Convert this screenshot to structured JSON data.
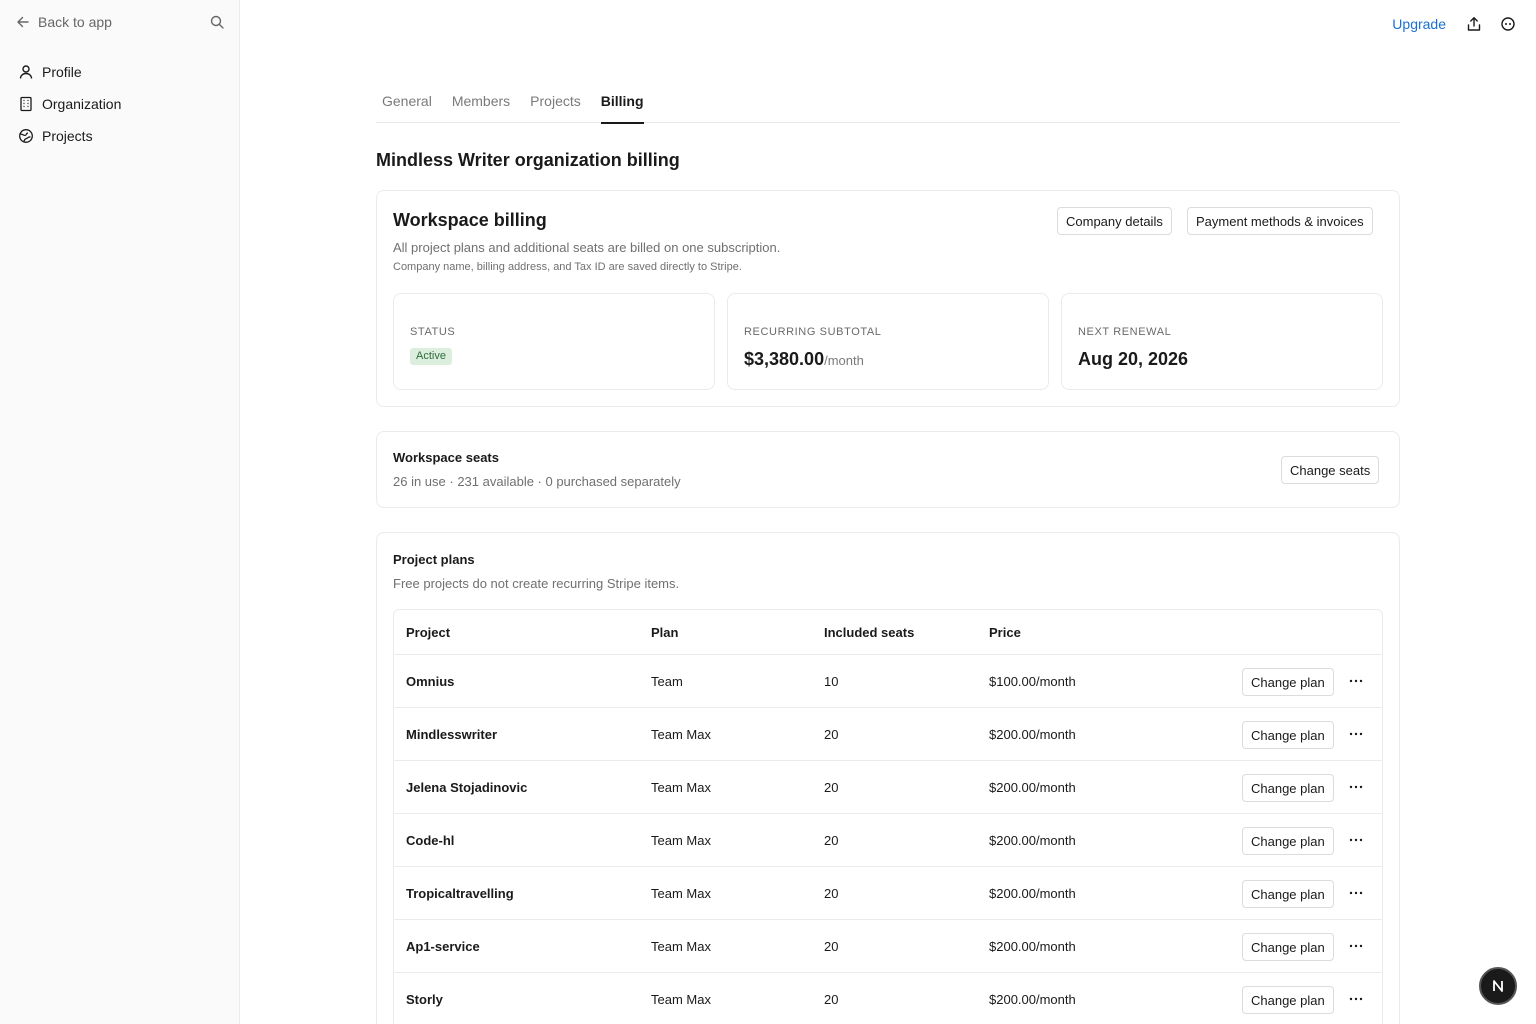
{
  "sidebar": {
    "back_label": "Back to app",
    "items": [
      {
        "label": "Profile",
        "icon": "user-icon"
      },
      {
        "label": "Organization",
        "icon": "building-icon"
      },
      {
        "label": "Projects",
        "icon": "globe-icon"
      }
    ]
  },
  "topbar": {
    "upgrade_label": "Upgrade"
  },
  "tabs": [
    {
      "label": "General",
      "active": false
    },
    {
      "label": "Members",
      "active": false
    },
    {
      "label": "Projects",
      "active": false
    },
    {
      "label": "Billing",
      "active": true
    }
  ],
  "page_title": "Mindless Writer organization billing",
  "workspace_billing": {
    "title": "Workspace billing",
    "subtitle": "All project plans and additional seats are billed on one subscription.",
    "note": "Company name, billing address, and Tax ID are saved directly to Stripe.",
    "company_details_label": "Company details",
    "payment_methods_label": "Payment methods & invoices",
    "stats": {
      "status_label": "STATUS",
      "status_value": "Active",
      "subtotal_label": "RECURRING SUBTOTAL",
      "subtotal_value": "$3,380.00",
      "subtotal_unit": "/month",
      "renewal_label": "NEXT RENEWAL",
      "renewal_value": "Aug 20, 2026"
    }
  },
  "workspace_seats": {
    "title": "Workspace seats",
    "summary": "26 in use · 231 available · 0 purchased separately",
    "change_seats_label": "Change seats"
  },
  "project_plans": {
    "title": "Project plans",
    "subtitle": "Free projects do not create recurring Stripe items.",
    "columns": [
      "Project",
      "Plan",
      "Included seats",
      "Price"
    ],
    "change_plan_label": "Change plan",
    "rows": [
      {
        "project": "Omnius",
        "plan": "Team",
        "seats": "10",
        "price": "$100.00/month"
      },
      {
        "project": "Mindlesswriter",
        "plan": "Team Max",
        "seats": "20",
        "price": "$200.00/month"
      },
      {
        "project": "Jelena Stojadinovic",
        "plan": "Team Max",
        "seats": "20",
        "price": "$200.00/month"
      },
      {
        "project": "Code-hl",
        "plan": "Team Max",
        "seats": "20",
        "price": "$200.00/month"
      },
      {
        "project": "Tropicaltravelling",
        "plan": "Team Max",
        "seats": "20",
        "price": "$200.00/month"
      },
      {
        "project": "Ap1-service",
        "plan": "Team Max",
        "seats": "20",
        "price": "$200.00/month"
      },
      {
        "project": "Storly",
        "plan": "Team Max",
        "seats": "20",
        "price": "$200.00/month"
      }
    ]
  },
  "fab_letter": "N",
  "colors": {
    "accent": "#1a6fd4",
    "badge_bg": "#dcefdf",
    "badge_text": "#2f6b3a"
  }
}
